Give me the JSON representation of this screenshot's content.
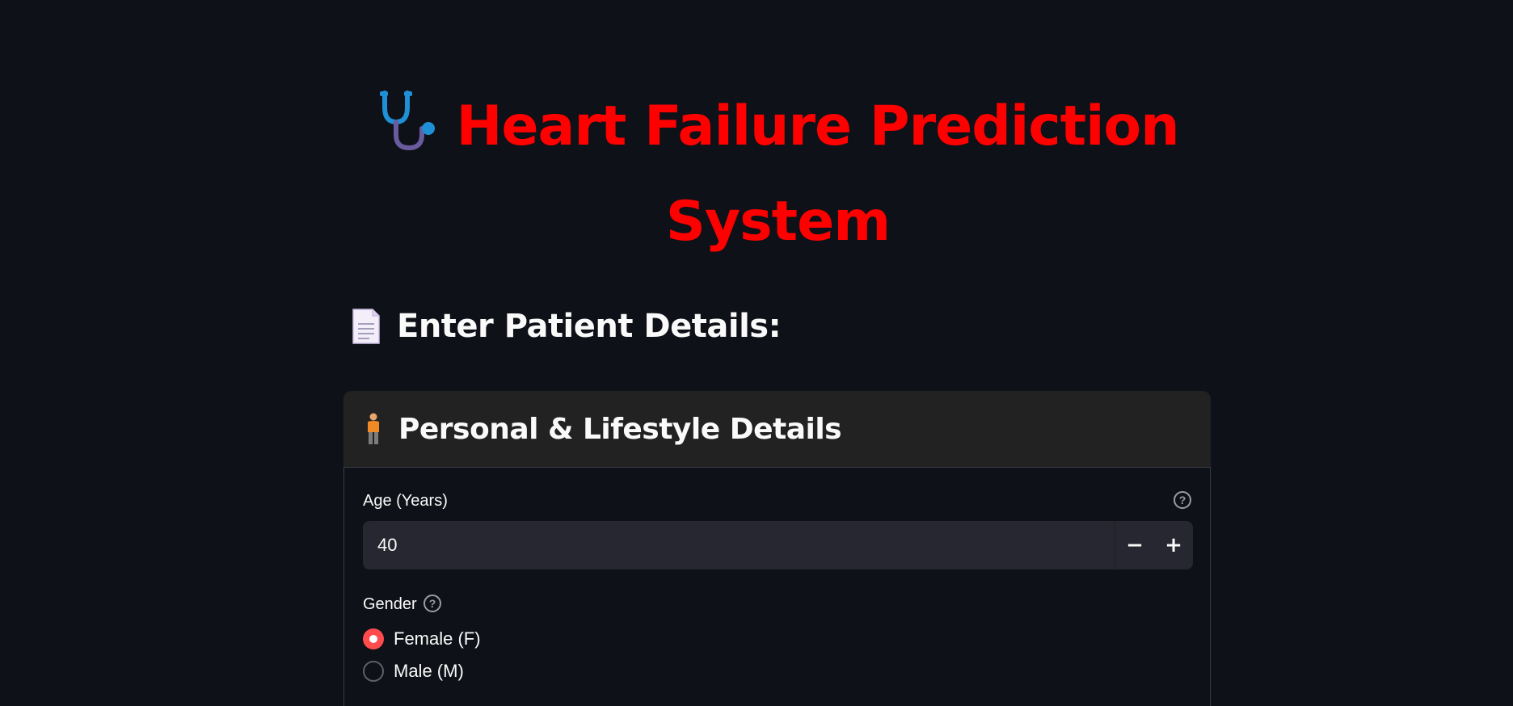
{
  "title": {
    "text": "Heart Failure Prediction System",
    "icon": "stethoscope-icon"
  },
  "section": {
    "heading": "Enter Patient Details:",
    "icon": "page-document-icon"
  },
  "expander": {
    "heading": "Personal & Lifestyle Details",
    "icon": "person-icon"
  },
  "age": {
    "label": "Age (Years)",
    "value": "40",
    "decrement": "−",
    "increment": "+"
  },
  "gender": {
    "label": "Gender",
    "options": [
      {
        "label": "Female (F)",
        "selected": true
      },
      {
        "label": "Male (M)",
        "selected": false
      }
    ]
  },
  "colors": {
    "background": "#0e1117",
    "title": "#ff0000",
    "accent": "#ff4b4b",
    "input_bg": "#262730",
    "expander_header_bg": "#222222"
  }
}
